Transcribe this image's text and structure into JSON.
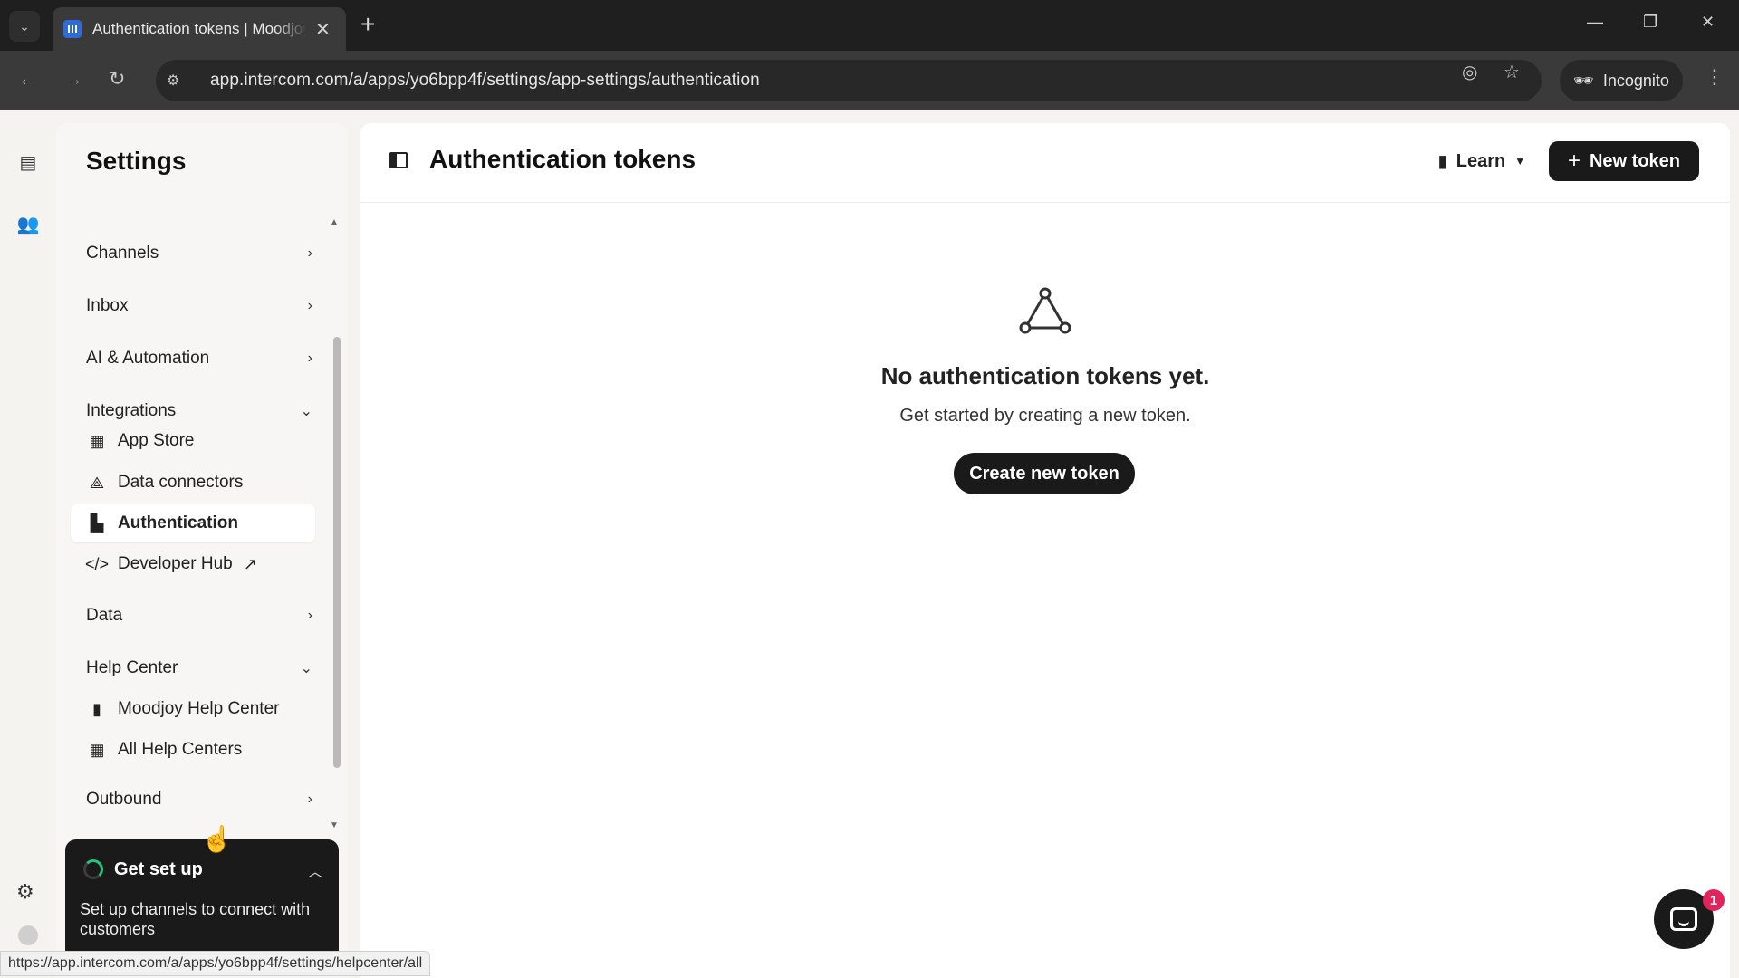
{
  "browser": {
    "tab_title": "Authentication tokens | Moodjoy",
    "url": "app.intercom.com/a/apps/yo6bpp4f/settings/app-settings/authentication",
    "incognito_label": "Incognito",
    "status_url": "https://app.intercom.com/a/apps/yo6bpp4f/settings/helpcenter/all"
  },
  "sidebar": {
    "title": "Settings",
    "sections": {
      "channels": "Channels",
      "inbox": "Inbox",
      "ai_automation": "AI & Automation",
      "integrations": "Integrations",
      "data": "Data",
      "help_center": "Help Center",
      "outbound": "Outbound"
    },
    "integrations_items": {
      "app_store": "App Store",
      "data_connectors": "Data connectors",
      "authentication": "Authentication",
      "developer_hub": "Developer Hub"
    },
    "help_center_items": {
      "moodjoy": "Moodjoy Help Center",
      "all": "All Help Centers"
    },
    "active_item": "Authentication"
  },
  "setup_card": {
    "title": "Get set up",
    "text": "Set up channels to connect with customers"
  },
  "main": {
    "title": "Authentication tokens",
    "learn_label": "Learn",
    "new_token_label": "New token",
    "empty_title": "No authentication tokens yet.",
    "empty_subtitle": "Get started by creating a new token.",
    "create_label": "Create new token"
  },
  "messenger": {
    "badge_count": "1"
  },
  "colors": {
    "accent_dark": "#1a1a1a",
    "badge": "#e0245e",
    "setup_progress": "#27c27b"
  }
}
